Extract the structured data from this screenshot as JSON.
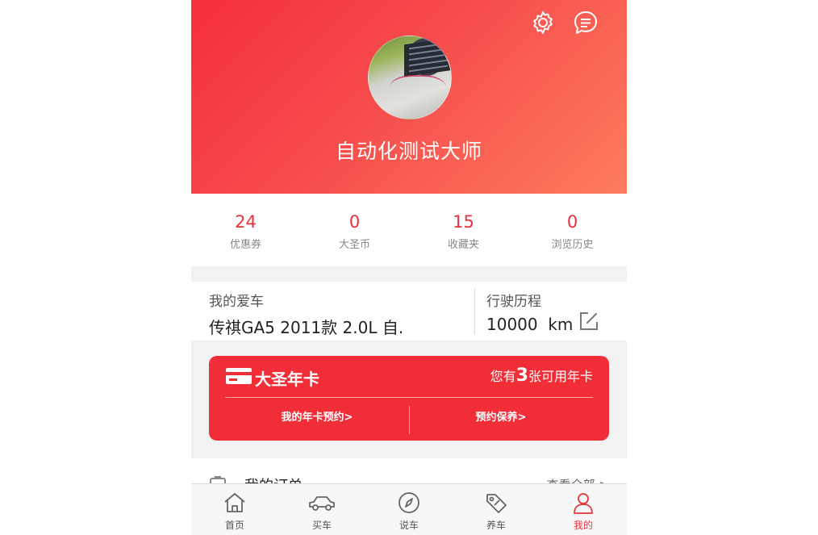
{
  "profile": {
    "username": "自动化测试大师",
    "icons": [
      "gear-icon",
      "message-icon"
    ]
  },
  "stats": [
    {
      "value": "24",
      "label": "优惠券"
    },
    {
      "value": "0",
      "label": "大圣币"
    },
    {
      "value": "15",
      "label": "收藏夹"
    },
    {
      "value": "0",
      "label": "浏览历史"
    }
  ],
  "car": {
    "label": "我的爱车",
    "model": "传祺GA5 2011款 2.0L 自.",
    "mileage_label": "行驶历程",
    "mileage_value": "10000",
    "mileage_unit": "km"
  },
  "year_card": {
    "title": "大圣年卡",
    "count_prefix": "您有",
    "count": "3",
    "count_suffix": "张可用年卡",
    "link_booking": "我的年卡预约>",
    "link_service": "预约保养>"
  },
  "orders": {
    "title": "我的订单",
    "more": "查看全部"
  },
  "tabs": [
    {
      "label": "首页",
      "icon": "home-icon"
    },
    {
      "label": "买车",
      "icon": "car-icon"
    },
    {
      "label": "说车",
      "icon": "compass-icon"
    },
    {
      "label": "养车",
      "icon": "tag-icon"
    },
    {
      "label": "我的",
      "icon": "user-icon",
      "active": true
    }
  ],
  "colors": {
    "accent": "#e8323c",
    "card": "#f12d38",
    "header_start": "#f42f3c",
    "header_end": "#fd7c5e"
  }
}
